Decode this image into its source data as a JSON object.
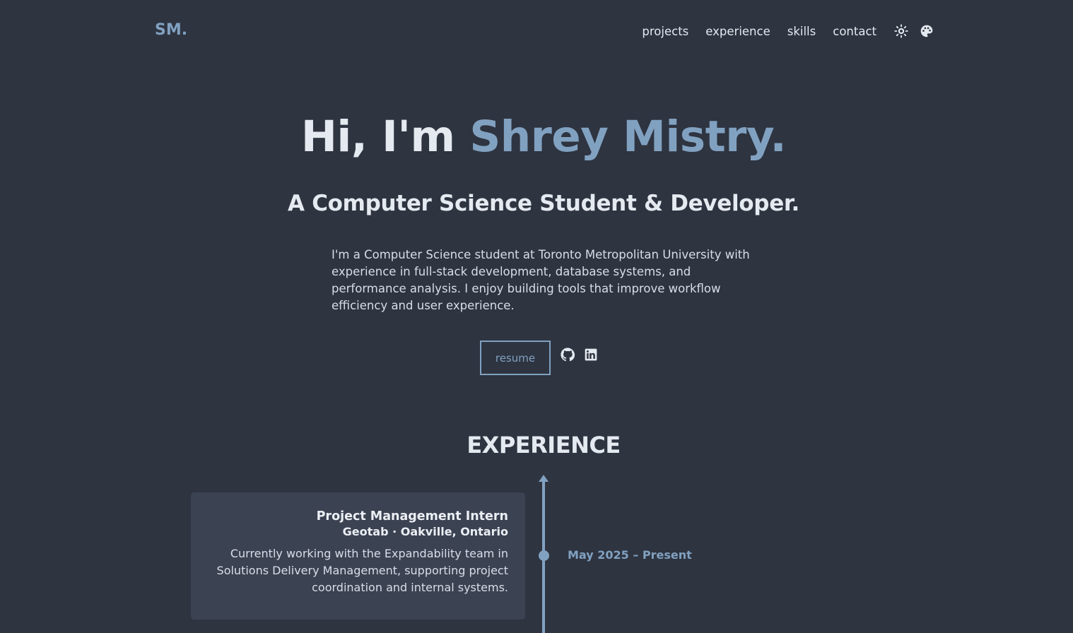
{
  "nav": {
    "logo": "SM.",
    "links": [
      "projects",
      "experience",
      "skills",
      "contact"
    ],
    "icons": [
      "theme-toggle-icon",
      "palette-icon"
    ]
  },
  "hero": {
    "greeting": "Hi, I'm ",
    "name": "Shrey Mistry.",
    "subtitle": "A Computer Science Student & Developer.",
    "description": "I'm a Computer Science student at Toronto Metropolitan University with experience in full-stack development, database systems, and performance analysis. I enjoy building tools that improve workflow efficiency and user experience.",
    "resume_label": "resume",
    "social_icons": [
      "github-icon",
      "linkedin-icon"
    ]
  },
  "experience": {
    "title": "EXPERIENCE",
    "items": [
      {
        "role": "Project Management Intern",
        "company": "Geotab · Oakville, Ontario",
        "description": "Currently working with the Expandability team in Solutions Delivery Management, supporting project coordination and internal systems.",
        "date": "May 2025 – Present"
      }
    ]
  },
  "colors": {
    "background": "#2e3440",
    "accent": "#81a1c1",
    "card": "#3b4252",
    "text": "#e5e9f0"
  }
}
